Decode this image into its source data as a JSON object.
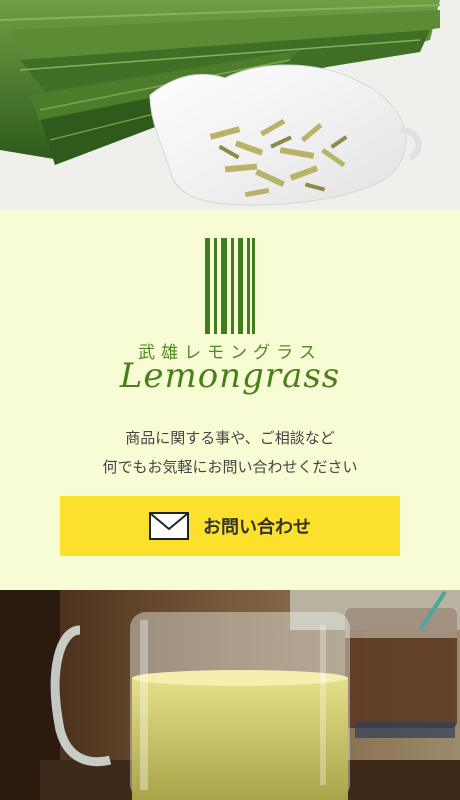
{
  "hero": {
    "image": "lemongrass-stalks-and-dried-tea-photo"
  },
  "brand": {
    "name_jp": "武雄レモングラス",
    "name_en": "Lemongrass",
    "color": "#4a7f1b"
  },
  "contact": {
    "lead_line1": "商品に関する事や、ご相談など",
    "lead_line2": "何でもお気軽にお問い合わせください",
    "button_label": "お問い合わせ",
    "button_icon": "mail-icon",
    "button_color": "#fbe12c"
  },
  "footer_photo": {
    "image": "glass-mug-of-lemongrass-tea-photo"
  }
}
